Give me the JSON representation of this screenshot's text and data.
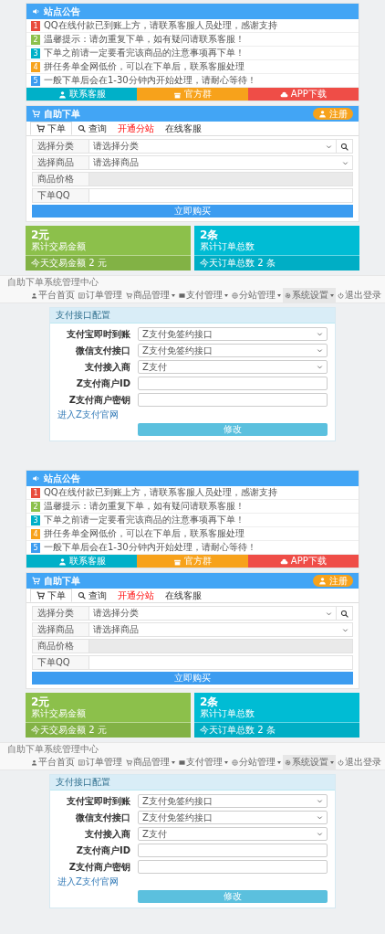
{
  "pages": [
    {
      "notice": {
        "title": "站点公告",
        "items": [
          {
            "num": "1",
            "color": "#e84c3d",
            "text": "QQ在线付款已到账上方，请联系客服人员处理，感谢支持"
          },
          {
            "num": "2",
            "color": "#8cc04b",
            "text": "温馨提示：请勿重复下单，如有疑问请联系客服！"
          },
          {
            "num": "3",
            "color": "#00b0c8",
            "text": "下单之前请一定要看完该商品的注意事项再下单！"
          },
          {
            "num": "4",
            "color": "#f7a21b",
            "text": "拼任务单全网低价，可以在下单后，联系客服处理"
          },
          {
            "num": "5",
            "color": "#3c9cf0",
            "text": "一般下单后会在1-30分钟内开始处理，请耐心等待！"
          }
        ],
        "buttons": [
          {
            "label": "联系客服",
            "color": "#00b0c8"
          },
          {
            "label": "官方群",
            "color": "#f7a21b"
          },
          {
            "label": "APP下载",
            "color": "#ef4d47"
          }
        ]
      },
      "order": {
        "title": "自助下单",
        "register": "注册",
        "tabs": [
          {
            "label": "下单",
            "selected": true,
            "kind": "normal"
          },
          {
            "label": "查询",
            "selected": false,
            "kind": "normal"
          },
          {
            "label": "开通分站",
            "selected": false,
            "kind": "highlight"
          },
          {
            "label": "在线客服",
            "selected": false,
            "kind": "normal"
          }
        ],
        "fields": [
          {
            "kind": "select_search",
            "label": "选择分类",
            "value": "请选择分类"
          },
          {
            "kind": "select",
            "label": "选择商品",
            "value": "请选择商品"
          },
          {
            "kind": "readonly",
            "label": "商品价格"
          },
          {
            "kind": "input",
            "label": "下单QQ"
          }
        ],
        "submit": "立即购买"
      },
      "stats": [
        {
          "value": "2元",
          "caption": "累计交易金额",
          "footer": "今天交易金额 2 元",
          "color": "#8cc04b"
        },
        {
          "value": "2条",
          "caption": "累计订单总数",
          "footer": "今天订单总数 2 条",
          "color": "#00bcd4"
        }
      ],
      "navbar": {
        "brand": "自助下单系统管理中心",
        "items": [
          {
            "label": "平台首页",
            "dropdown": false,
            "selected": false
          },
          {
            "label": "订单管理",
            "dropdown": false,
            "selected": false
          },
          {
            "label": "商品管理",
            "dropdown": true,
            "selected": false
          },
          {
            "label": "支付管理",
            "dropdown": true,
            "selected": false
          },
          {
            "label": "分站管理",
            "dropdown": true,
            "selected": false
          },
          {
            "label": "系统设置",
            "dropdown": true,
            "selected": true
          },
          {
            "label": "退出登录",
            "dropdown": false,
            "selected": false
          }
        ]
      },
      "pay_config": {
        "title": "支付接口配置",
        "fields": [
          {
            "kind": "select",
            "label": "支付宝即时到账",
            "value": "Z支付免签约接口"
          },
          {
            "kind": "select",
            "label": "微信支付接口",
            "value": "Z支付免签约接口"
          },
          {
            "kind": "select",
            "label": "支付接入商",
            "value": "Z支付"
          },
          {
            "kind": "input",
            "label": "Z支付商户ID"
          },
          {
            "kind": "input",
            "label": "Z支付商户密钥"
          }
        ],
        "link": "进入Z支付官网",
        "submit": "修改"
      }
    },
    {
      "notice": {
        "title": "站点公告",
        "items": [
          {
            "num": "1",
            "color": "#e84c3d",
            "text": "QQ在线付款已到账上方，请联系客服人员处理，感谢支持"
          },
          {
            "num": "2",
            "color": "#8cc04b",
            "text": "温馨提示：请勿重复下单，如有疑问请联系客服！"
          },
          {
            "num": "3",
            "color": "#00b0c8",
            "text": "下单之前请一定要看完该商品的注意事项再下单！"
          },
          {
            "num": "4",
            "color": "#f7a21b",
            "text": "拼任务单全网低价，可以在下单后，联系客服处理"
          },
          {
            "num": "5",
            "color": "#3c9cf0",
            "text": "一般下单后会在1-30分钟内开始处理，请耐心等待！"
          }
        ],
        "buttons": [
          {
            "label": "联系客服",
            "color": "#00b0c8"
          },
          {
            "label": "官方群",
            "color": "#f7a21b"
          },
          {
            "label": "APP下载",
            "color": "#ef4d47"
          }
        ]
      },
      "order": {
        "title": "自助下单",
        "register": "注册",
        "tabs": [
          {
            "label": "下单",
            "selected": true,
            "kind": "normal"
          },
          {
            "label": "查询",
            "selected": false,
            "kind": "normal"
          },
          {
            "label": "开通分站",
            "selected": false,
            "kind": "highlight"
          },
          {
            "label": "在线客服",
            "selected": false,
            "kind": "normal"
          }
        ],
        "fields": [
          {
            "kind": "select_search",
            "label": "选择分类",
            "value": "请选择分类"
          },
          {
            "kind": "select",
            "label": "选择商品",
            "value": "请选择商品"
          },
          {
            "kind": "readonly",
            "label": "商品价格"
          },
          {
            "kind": "input",
            "label": "下单QQ"
          }
        ],
        "submit": "立即购买"
      },
      "stats": [
        {
          "value": "2元",
          "caption": "累计交易金额",
          "footer": "今天交易金额 2 元",
          "color": "#8cc04b"
        },
        {
          "value": "2条",
          "caption": "累计订单总数",
          "footer": "今天订单总数 2 条",
          "color": "#00bcd4"
        }
      ],
      "navbar": {
        "brand": "自助下单系统管理中心",
        "items": [
          {
            "label": "平台首页",
            "dropdown": false,
            "selected": false
          },
          {
            "label": "订单管理",
            "dropdown": false,
            "selected": false
          },
          {
            "label": "商品管理",
            "dropdown": true,
            "selected": false
          },
          {
            "label": "支付管理",
            "dropdown": true,
            "selected": false
          },
          {
            "label": "分站管理",
            "dropdown": true,
            "selected": false
          },
          {
            "label": "系统设置",
            "dropdown": true,
            "selected": true
          },
          {
            "label": "退出登录",
            "dropdown": false,
            "selected": false
          }
        ]
      },
      "pay_config": {
        "title": "支付接口配置",
        "fields": [
          {
            "kind": "select",
            "label": "支付宝即时到账",
            "value": "Z支付免签约接口"
          },
          {
            "kind": "select",
            "label": "微信支付接口",
            "value": "Z支付免签约接口"
          },
          {
            "kind": "select",
            "label": "支付接入商",
            "value": "Z支付"
          },
          {
            "kind": "input",
            "label": "Z支付商户ID"
          },
          {
            "kind": "input",
            "label": "Z支付商户密钥"
          }
        ],
        "link": "进入Z支付官网",
        "submit": "修改"
      }
    }
  ]
}
